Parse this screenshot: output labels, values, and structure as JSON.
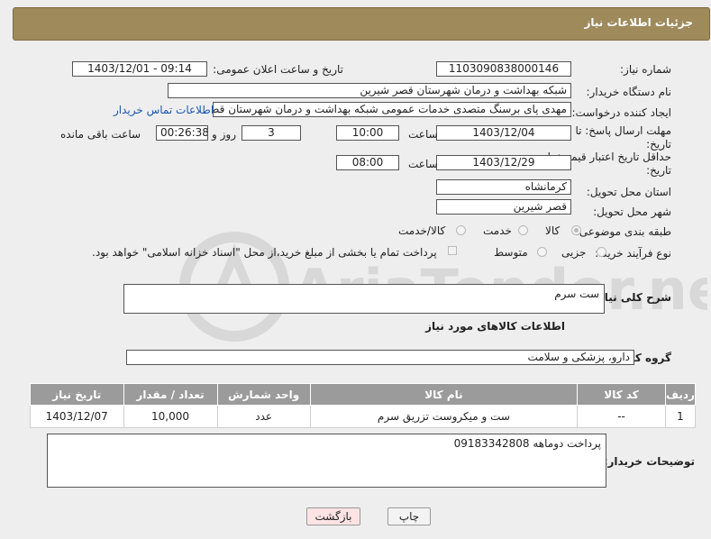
{
  "header": {
    "title": "جزئیات اطلاعات نیاز"
  },
  "form": {
    "need_number_label": "شماره نیاز:",
    "need_number": "1103090838000146",
    "announce_label": "تاریخ و ساعت اعلان عمومی:",
    "announce_value": "1403/12/01 - 09:14",
    "buyer_org_label": "نام دستگاه خریدار:",
    "buyer_org": "شبکه بهداشت و درمان شهرستان قصر شیرین",
    "creator_label": "ایجاد کننده درخواست:",
    "creator": "مهدی پای برسنگ متصدی خدمات عمومی شبکه بهداشت و درمان شهرستان قصر شیرین",
    "contact_link": "اطلاعات تماس خریدار",
    "deadline_label": "مهلت ارسال پاسخ: تا تاریخ:",
    "deadline_date": "1403/12/04",
    "time_label": "ساعت",
    "deadline_time": "10:00",
    "days_value": "3",
    "days_label": "روز و",
    "remaining_value": "00:26:38",
    "remaining_label": "ساعت باقی مانده",
    "validity_label": "حداقل تاریخ اعتبار قیمت: تا تاریخ:",
    "validity_date": "1403/12/29",
    "validity_time": "08:00",
    "province_label": "استان محل تحویل:",
    "province": "کرمانشاه",
    "city_label": "شهر محل تحویل:",
    "city": "قصر شیرین",
    "category_label": "طبقه بندی موضوعی:",
    "category_options": [
      "کالا",
      "خدمت",
      "کالا/خدمت"
    ],
    "process_label": "نوع فرآیند خرید :",
    "process_options": [
      "جزیی",
      "متوسط"
    ],
    "payment_note": "پرداخت تمام یا بخشی از مبلغ خرید،از محل \"اسناد خزانه اسلامی\" خواهد بود."
  },
  "summary": {
    "label": "شرح کلی نیاز:",
    "value": "ست سرم"
  },
  "goods_info_title": "اطلاعات کالاهای مورد نیاز",
  "goods_group": {
    "label": "گروه کالا:",
    "value": "دارو، پزشکی و سلامت"
  },
  "table": {
    "headers": [
      "ردیف",
      "کد کالا",
      "نام کالا",
      "واحد شمارش",
      "تعداد / مقدار",
      "تاریخ نیاز"
    ],
    "rows": [
      [
        "1",
        "--",
        "ست و میکروست تزریق سرم",
        "عدد",
        "10,000",
        "1403/12/07"
      ]
    ]
  },
  "buyer_notes": {
    "label": "توضیحات خریدار:",
    "value": "پرداخت دوماهه 09183342808"
  },
  "buttons": {
    "print": "چاپ",
    "back": "بازگشت"
  },
  "watermark": {
    "text": "AriaTender.neT"
  },
  "colors": {
    "header_bg": "#9f8a5c",
    "table_header_bg": "#9b9b9b",
    "link": "#1a56b0",
    "back_btn_bg": "#fde3e3"
  }
}
